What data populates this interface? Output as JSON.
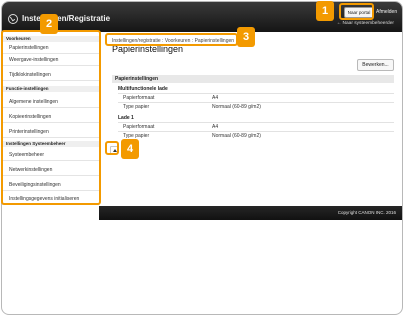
{
  "header": {
    "title": "Instellingen/Registratie",
    "portal_button": "Naar portal",
    "logout": "Afmelden",
    "back_link": "Naar systeembeheerder"
  },
  "sidebar": {
    "groups": [
      {
        "title": "Voorkeuren",
        "items": [
          {
            "label": "Papierinstellingen"
          },
          {
            "label": "Weergave-instellingen"
          },
          {
            "label": "Tijdklokinstellingen"
          }
        ]
      },
      {
        "title": "Functie-instellingen",
        "items": [
          {
            "label": "Algemene instellingen"
          },
          {
            "label": "Kopieerinstellingen"
          },
          {
            "label": "Printerinstellingen"
          }
        ]
      },
      {
        "title": "Instellingen Systeembeheer",
        "items": [
          {
            "label": "Systeembeheer"
          },
          {
            "label": "Netwerkinstellingen"
          },
          {
            "label": "Beveiligingsinstellingen"
          },
          {
            "label": "Instellingsgegevens initialiseren"
          }
        ]
      }
    ]
  },
  "main": {
    "breadcrumb": [
      "Instellingen/registratie",
      "Voorkeuren",
      "Papierinstellingen"
    ],
    "breadcrumb_sep": ":",
    "title": "Papierinstellingen",
    "edit_button": "Bewerken...",
    "section_title": "Papierinstellingen",
    "groups": [
      {
        "title": "Multifunctionele lade",
        "rows": [
          {
            "label": "Papierformaat",
            "value": "A4"
          },
          {
            "label": "Type papier",
            "value": "Normaal (60-89 g/m2)"
          }
        ]
      },
      {
        "title": "Lade 1",
        "rows": [
          {
            "label": "Papierformaat",
            "value": "A4"
          },
          {
            "label": "Type papier",
            "value": "Normaal (60-89 g/m2)"
          }
        ]
      }
    ]
  },
  "footer": {
    "copyright": "Copyright CANON INC. 2016"
  },
  "callouts": [
    "1",
    "2",
    "3",
    "4"
  ],
  "colors": {
    "callout": "#f39a00",
    "header": "#1e1e1e",
    "footer": "#1a1a1a"
  }
}
